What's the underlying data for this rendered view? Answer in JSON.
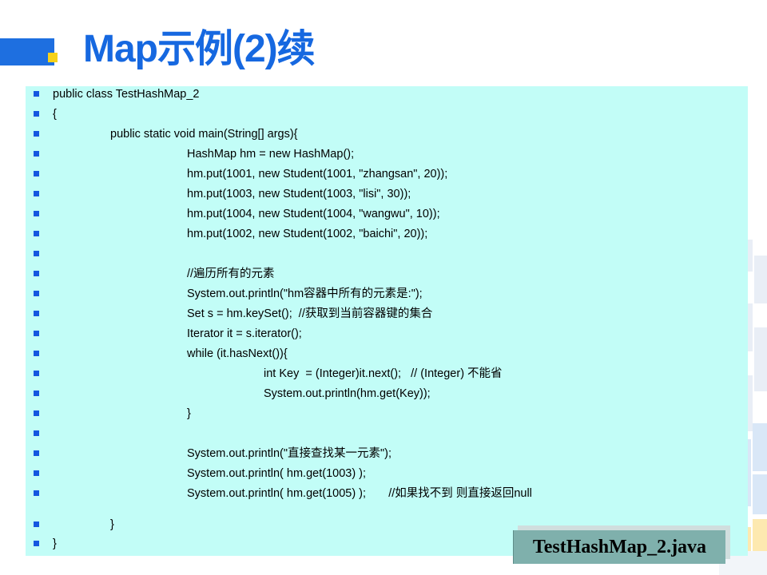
{
  "title": "Map示例(2)续",
  "code_lines": [
    "public class TestHashMap_2",
    "{",
    "public static void main(String[] args){",
    "HashMap hm = new HashMap();",
    "hm.put(1001, new Student(1001, \"zhangsan\", 20));",
    "hm.put(1003, new Student(1003, \"lisi\", 30));",
    "hm.put(1004, new Student(1004, \"wangwu\", 10));",
    "hm.put(1002, new Student(1002, \"baichi\", 20));",
    "",
    "//遍历所有的元素",
    "System.out.println(\"hm容器中所有的元素是:\");",
    "Set s = hm.keySet();  //获取到当前容器键的集合",
    "Iterator it = s.iterator();",
    "while (it.hasNext()){",
    "int Key  = (Integer)it.next();   // (Integer) 不能省",
    "System.out.println(hm.get(Key));",
    "}",
    "",
    "System.out.println(\"直接查找某一元素\");",
    "System.out.println( hm.get(1003) );",
    "System.out.println( hm.get(1005) );       //如果找不到 则直接返回null",
    "}",
    "}"
  ],
  "file_label": "TestHashMap_2.java",
  "colors": {
    "title": "#1668e0",
    "code_background": "#c2fdf7",
    "bullet": "#1557e0",
    "label_background": "#7fb0ac",
    "accent_bar": "#1e6fe0",
    "accent_square": "#f7d21a"
  }
}
